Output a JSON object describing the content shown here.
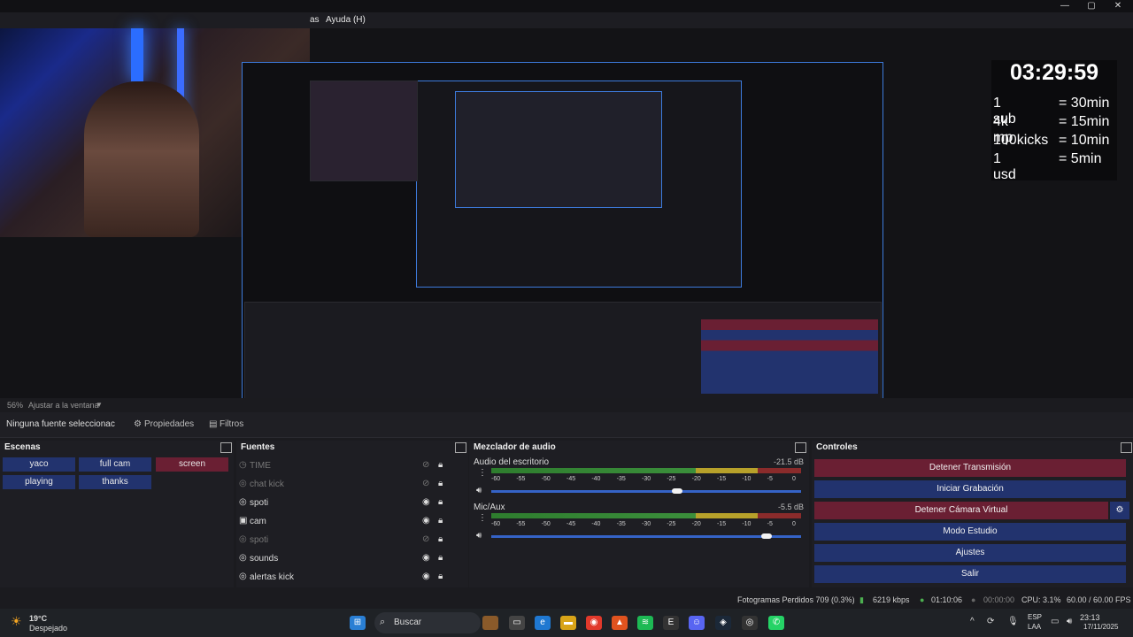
{
  "window": {
    "menu": [
      "as",
      "Ayuda (H)"
    ],
    "controls": [
      "—",
      "▢",
      "✕"
    ]
  },
  "preview": {
    "timer": {
      "clock": "03:29:59",
      "rules": [
        {
          "left": "1 sub",
          "right": "= 30min"
        },
        {
          "left": "4k mp",
          "right": "= 15min"
        },
        {
          "left": "100kicks",
          "right": "= 10min"
        },
        {
          "left": "1 usd",
          "right": "= 5min"
        }
      ]
    }
  },
  "zoom": {
    "percent": "56%",
    "fit_label": "Ajustar a la ventana"
  },
  "props_bar": {
    "no_source": "Ninguna fuente seleccionac",
    "properties": "Propiedades",
    "filters": "Filtros"
  },
  "scenes": {
    "title": "Escenas",
    "items": [
      "yaco",
      "full cam",
      "screen",
      "playing",
      "thanks"
    ],
    "active": "screen"
  },
  "sources": {
    "title": "Fuentes",
    "items": [
      {
        "name": "TIME",
        "visible": false
      },
      {
        "name": "chat kick",
        "visible": false
      },
      {
        "name": "spoti",
        "visible": true
      },
      {
        "name": "cam",
        "visible": true
      },
      {
        "name": "spoti",
        "visible": false
      },
      {
        "name": "sounds",
        "visible": true
      },
      {
        "name": "alertas kick",
        "visible": true
      }
    ]
  },
  "mixer": {
    "title": "Mezclador de audio",
    "ticks": [
      "-60",
      "-55",
      "-50",
      "-45",
      "-40",
      "-35",
      "-30",
      "-25",
      "-20",
      "-15",
      "-10",
      "-5",
      "0"
    ],
    "channels": [
      {
        "name": "Audio del escritorio",
        "db": "-21.5 dB",
        "level": 0.62
      },
      {
        "name": "Mic/Aux",
        "db": "-5.5 dB",
        "level": 0.92
      }
    ]
  },
  "controls": {
    "title": "Controles",
    "buttons": [
      {
        "label": "Detener Transmisión",
        "style": "red"
      },
      {
        "label": "Iniciar Grabación",
        "style": "blue"
      },
      {
        "label": "Detener Cámara Virtual",
        "style": "red"
      },
      {
        "label": "Modo Estudio",
        "style": "blue"
      },
      {
        "label": "Ajustes",
        "style": "blue"
      },
      {
        "label": "Salir",
        "style": "blue"
      }
    ]
  },
  "status": {
    "dropped": "Fotogramas Perdidos 709 (0.3%)",
    "bitrate": "6219 kbps",
    "stream_time": "01:10:06",
    "rec_time": "00:00:00",
    "cpu": "CPU: 3.1%",
    "fps": "60.00 / 60.00 FPS"
  },
  "taskbar": {
    "weather_temp": "19°C",
    "weather_desc": "Despejado",
    "search": "Buscar",
    "lang1": "ESP",
    "lang2": "LAA",
    "time": "23:13",
    "date": "17/11/2025"
  },
  "colors": {
    "accent_blue": "#22336e",
    "accent_red": "#6a1f33",
    "border_blue": "#3d7bdc"
  }
}
